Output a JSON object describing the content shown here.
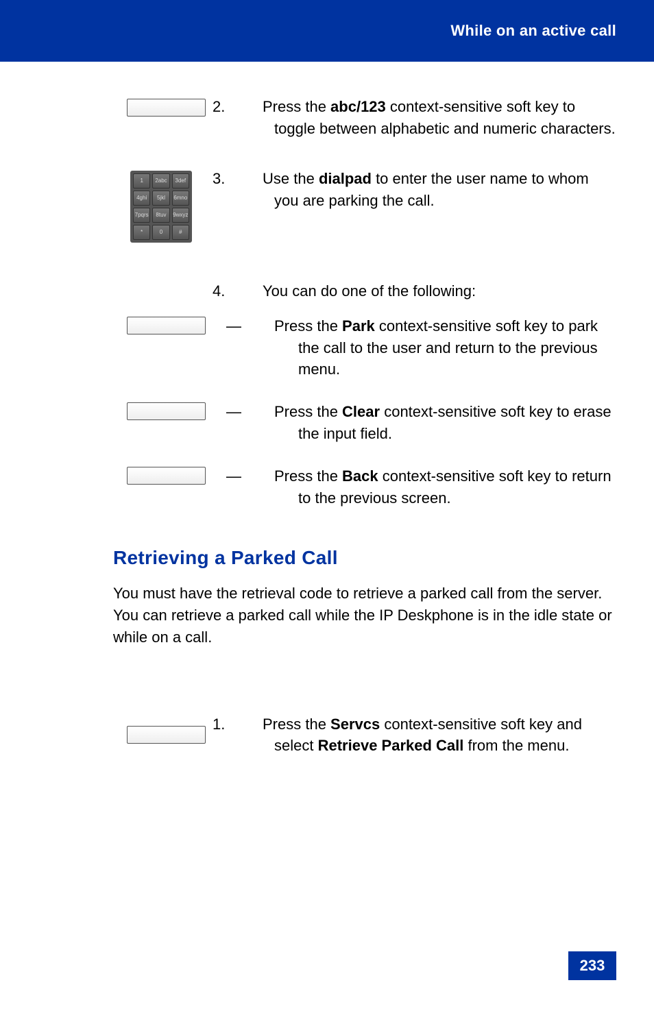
{
  "header": {
    "title": "While on an active call"
  },
  "steps": {
    "s2": {
      "num": "2.",
      "softkey": "abc",
      "text_before": "Press the ",
      "key_label": "abc/123",
      "text_after": " context-sensitive soft key to toggle between alphabetic and numeric characters."
    },
    "s3": {
      "num": "3.",
      "text_before": "Use the ",
      "key_label": "dialpad",
      "text_after": " to enter the user name to whom you are parking the call."
    },
    "s4": {
      "num": "4.",
      "text_intro": "You can do one of the following:",
      "items": [
        {
          "softkey": "Park",
          "text_before": "Press the ",
          "key_label": "Park",
          "text_after": " context-sensitive soft key to park the call to the user and return to the previous menu."
        },
        {
          "softkey": "Clear",
          "text_before": "Press the ",
          "key_label": "Clear",
          "text_after": " context-sensitive soft key to erase the input field."
        },
        {
          "softkey": "Back",
          "text_before": "Press the ",
          "key_label": "Back",
          "text_after": " context-sensitive soft key to return to the previous screen."
        }
      ]
    }
  },
  "section": {
    "heading": "Retrieving a Parked Call",
    "body": "You must have the retrieval code to retrieve a parked call from the server. You can retrieve a parked call while the IP Deskphone is in the idle state or while on a call."
  },
  "lower_step": {
    "num": "1.",
    "softkey": "Servcs",
    "text_before": "Press the ",
    "key_label": "Servcs",
    "text_mid": " context-sensitive soft key and select ",
    "menu_label": "Retrieve Parked Call",
    "text_after": " from the menu."
  },
  "page_number": "233",
  "dialpad": {
    "rows": [
      [
        "1",
        "2abc",
        "3def"
      ],
      [
        "4ghi",
        "5jkl",
        "6mno"
      ],
      [
        "7pqrs",
        "8tuv",
        "9wxyz"
      ],
      [
        "*",
        "0",
        "#"
      ]
    ]
  }
}
